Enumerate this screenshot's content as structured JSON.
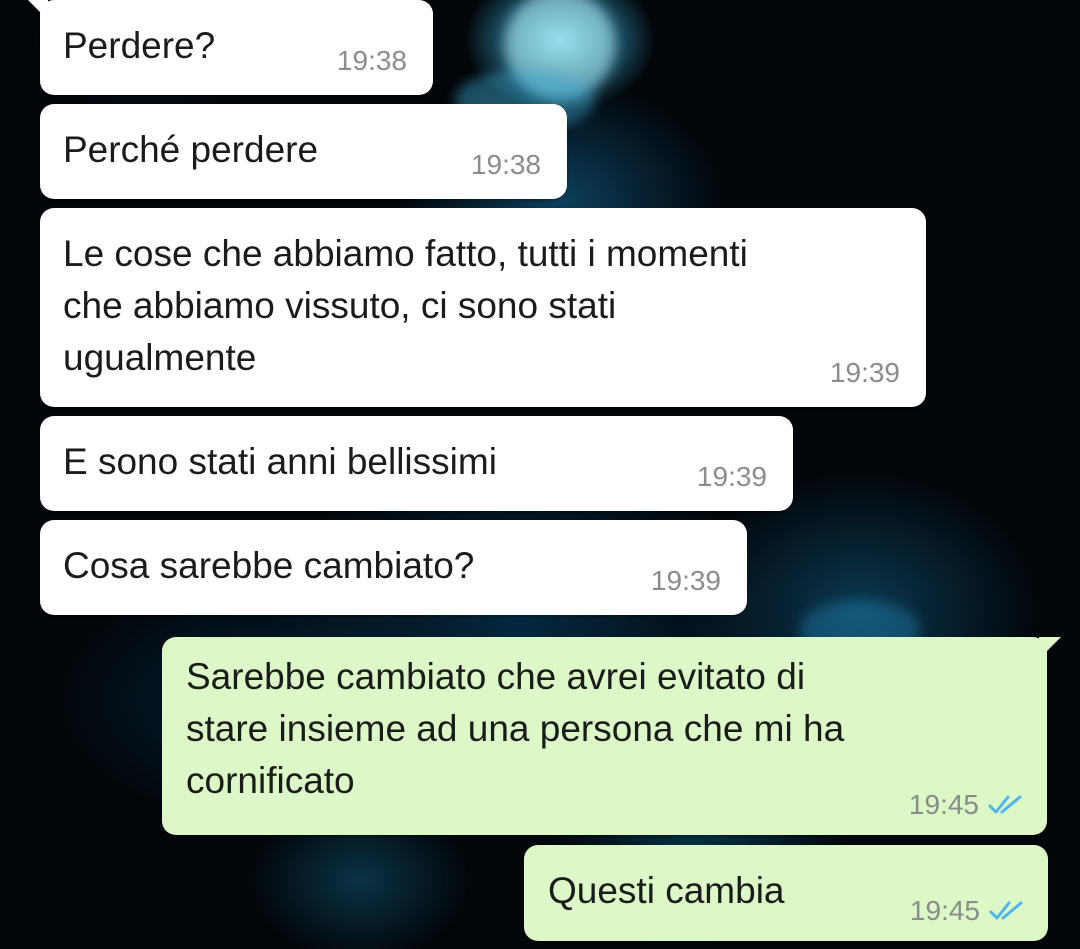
{
  "colors": {
    "incoming_bubble": "#ffffff",
    "outgoing_bubble": "#dcf8c6",
    "timestamp": "#8c8c8c",
    "read_check": "#4fb6ec",
    "wallpaper": "#020509"
  },
  "messages": [
    {
      "direction": "in",
      "text": "Perdere?",
      "time": "19:38"
    },
    {
      "direction": "in",
      "text": "Perché perdere",
      "time": "19:38"
    },
    {
      "direction": "in",
      "text": "Le cose che abbiamo fatto, tutti i momenti\nche abbiamo vissuto, ci sono stati\nugualmente",
      "time": "19:39"
    },
    {
      "direction": "in",
      "text": "E sono stati anni bellissimi",
      "time": "19:39"
    },
    {
      "direction": "in",
      "text": "Cosa sarebbe cambiato?",
      "time": "19:39"
    },
    {
      "direction": "out",
      "text": "Sarebbe cambiato che avrei evitato di\nstare insieme ad una persona che mi ha\ncornificato",
      "time": "19:45",
      "status_icon": "double-check-icon"
    },
    {
      "direction": "out",
      "text": "Questi cambia",
      "time": "19:45",
      "status_icon": "double-check-icon"
    }
  ]
}
